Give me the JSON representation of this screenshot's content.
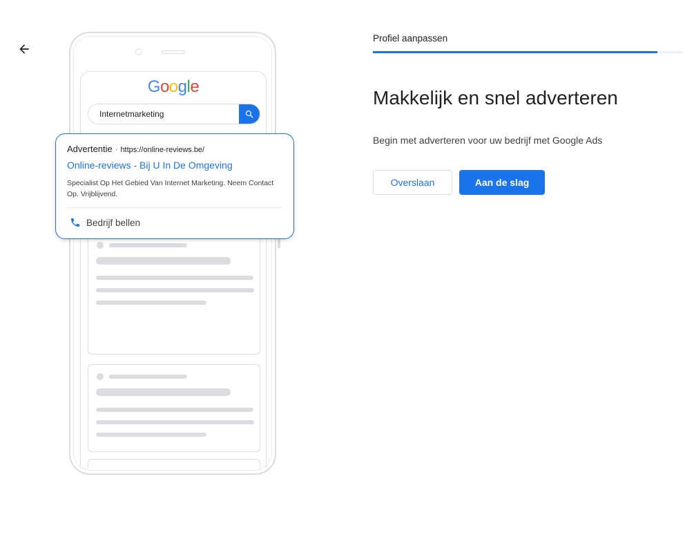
{
  "nav": {
    "back_icon": "arrow-left-icon"
  },
  "preview": {
    "logo_letters": [
      "G",
      "o",
      "o",
      "g",
      "l",
      "e"
    ],
    "search": {
      "query": "Internetmarketing",
      "icon": "search-icon"
    },
    "ad": {
      "label": "Advertentie",
      "separator": "·",
      "url": "https://online-reviews.be/",
      "title": "Online-reviews - Bij U In De Omgeving",
      "description": "Specialist Op Het Gebied Van Internet Marketing. Neem Contact Op. Vrijblijvend.",
      "call_label": "Bedrijf bellen",
      "call_icon": "phone-icon"
    }
  },
  "wizard": {
    "step_label": "Profiel aanpassen",
    "progress_percent": 92,
    "headline": "Makkelijk en snel adverteren",
    "subtext": "Begin met adverteren voor uw bedrijf met Google Ads",
    "skip_label": "Overslaan",
    "start_label": "Aan de slag"
  },
  "colors": {
    "accent": "#1a73e8",
    "placeholder": "#dadce0"
  }
}
